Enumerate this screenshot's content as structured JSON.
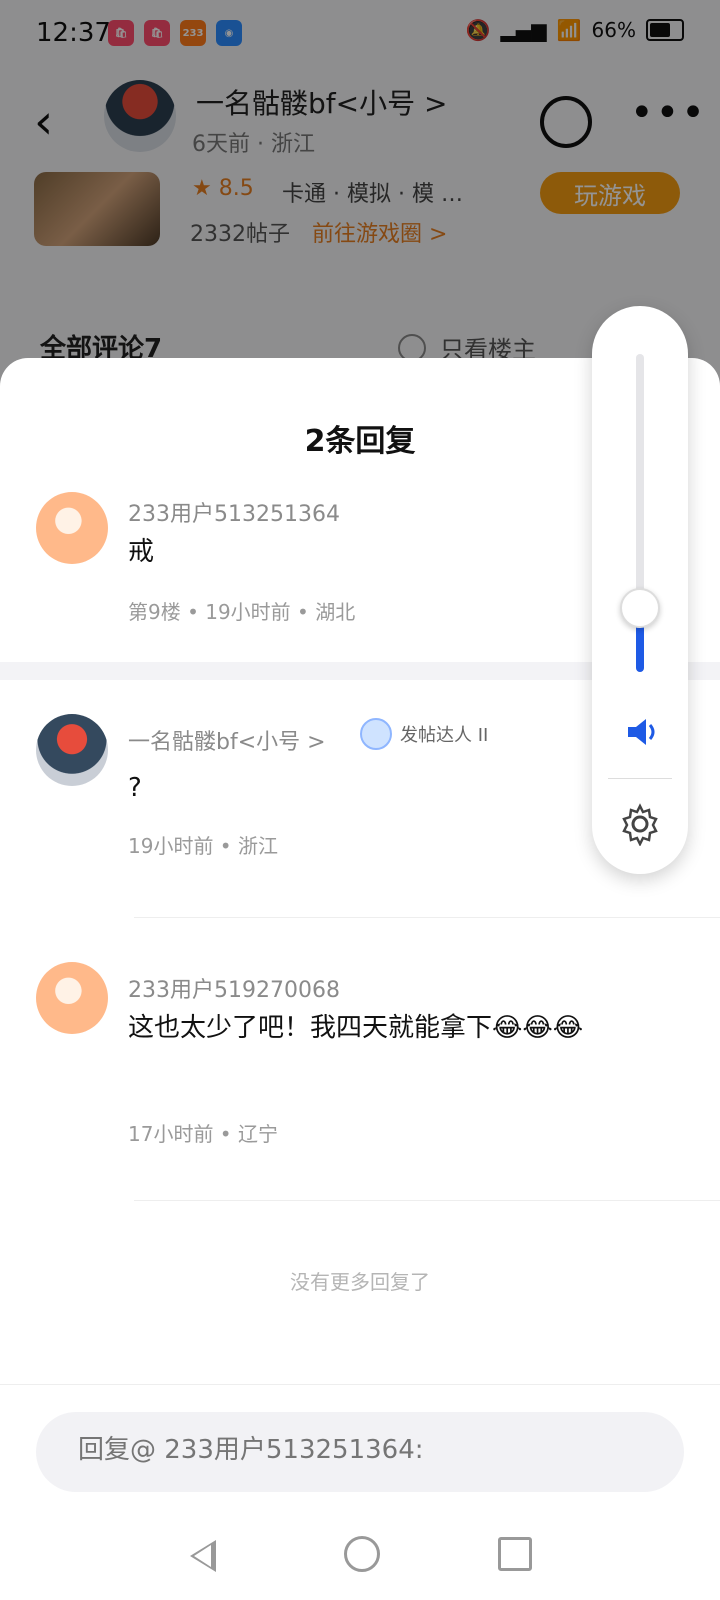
{
  "status_bar": {
    "time": "12:37",
    "apps": [
      "233"
    ],
    "battery": "66%"
  },
  "post": {
    "author": "一名骷髅bf<小号 >",
    "meta": "6天前 · 浙江"
  },
  "game": {
    "rating": "8.5",
    "tags": "卡通 · 模拟 · 模 …",
    "posts": "2332帖子",
    "link": "前往游戏圈 >",
    "play": "玩游戏"
  },
  "comments_header": {
    "title": "全部评论7",
    "op_only": "只看楼主"
  },
  "sheet": {
    "title": "2条回复",
    "replies": [
      {
        "name": "233用户513251364",
        "text": "戒",
        "meta": "第9楼 • 19小时前 • 湖北"
      },
      {
        "name": "一名骷髅bf<小号 >",
        "badge": "发帖达人 II",
        "text": "?",
        "meta": "19小时前 • 浙江"
      },
      {
        "name": "233用户519270068",
        "text": "这也太少了吧！我四天就能拿下😂😂😂",
        "meta": "17小时前 • 辽宁"
      }
    ],
    "no_more": "没有更多回复了",
    "reply_input": "回复@ 233用户513251364:"
  },
  "volume": {
    "level": 0.19,
    "colors": {
      "accent": "#1e5ae5"
    }
  }
}
